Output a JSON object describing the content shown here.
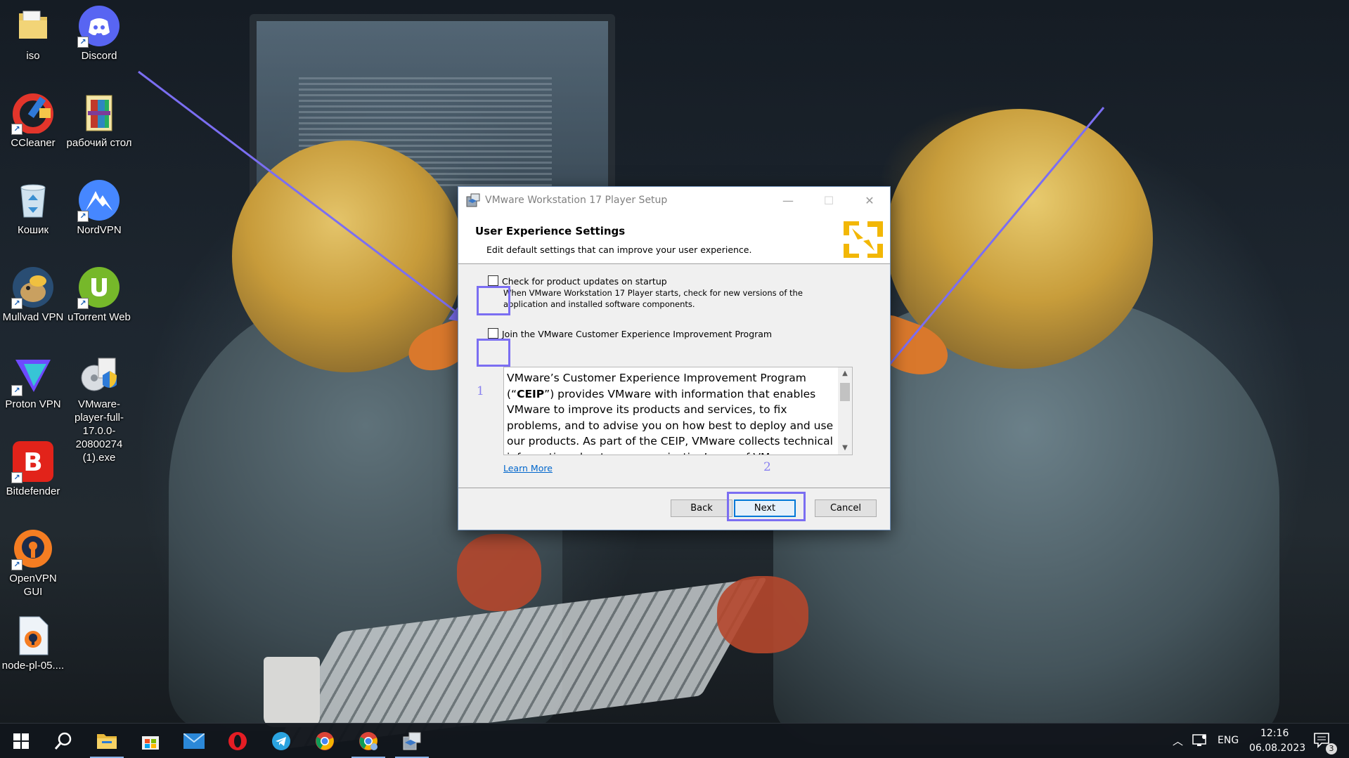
{
  "desktop": {
    "icons": [
      {
        "label": "iso",
        "icon": "folder-icon"
      },
      {
        "label": "Discord",
        "icon": "discord-icon"
      },
      {
        "label": "CCleaner",
        "icon": "ccleaner-icon"
      },
      {
        "label": "рабочий стол",
        "icon": "archive-icon"
      },
      {
        "label": "Кошик",
        "icon": "recycle-bin-icon"
      },
      {
        "label": "NordVPN",
        "icon": "nordvpn-icon"
      },
      {
        "label": "Mullvad VPN",
        "icon": "mullvad-icon"
      },
      {
        "label": "uTorrent Web",
        "icon": "utorrent-icon"
      },
      {
        "label": "Proton VPN",
        "icon": "protonvpn-icon"
      },
      {
        "label": "VMware-player-full-17.0.0-20800274 (1).exe",
        "icon": "installer-icon"
      },
      {
        "label": "Bitdefender",
        "icon": "bitdefender-icon"
      },
      {
        "label": "OpenVPN GUI",
        "icon": "openvpn-icon"
      },
      {
        "label": "node-pl-05....",
        "icon": "vpn-config-file-icon"
      }
    ]
  },
  "dialog": {
    "title": "VMware Workstation 17 Player Setup",
    "header_title": "User Experience Settings",
    "header_subtitle": "Edit default settings that can improve your user experience.",
    "option_updates_label": "Check for product updates on startup",
    "option_updates_desc_1": "When VMware Workstation 17 Player starts, check for new versions of the",
    "option_updates_desc_2": "application and installed software components.",
    "option_updates_checked": false,
    "option_ceip_label": "Join the VMware Customer Experience Improvement Program",
    "option_ceip_checked": false,
    "ceip_text_1": "VMware’s Customer Experience Improvement Program (“",
    "ceip_text_bold": "CEIP",
    "ceip_text_2": "”) provides VMware with information that enables VMware to improve its products and services, to fix problems, and to advise you on how best to deploy and use our products. As part of the CEIP, VMware collects technical information about your organization’s use of VMware",
    "learn_more": "Learn More",
    "back": "Back",
    "next": "Next",
    "cancel": "Cancel",
    "minimize": "—",
    "maximize": "☐",
    "close": "✕"
  },
  "annotations": {
    "step_1": "1",
    "step_2": "2",
    "color": "#7b6ef2"
  },
  "taskbar": {
    "pinned": [
      "windows-start-icon",
      "search-icon",
      "file-explorer-icon",
      "microsoft-store-icon",
      "mail-icon",
      "opera-icon",
      "telegram-icon",
      "chrome-icon",
      "chrome-profile-icon",
      "vmware-setup-icon"
    ],
    "language": "ENG",
    "time": "12:16",
    "date": "06.08.2023",
    "notifications_count": "3"
  }
}
